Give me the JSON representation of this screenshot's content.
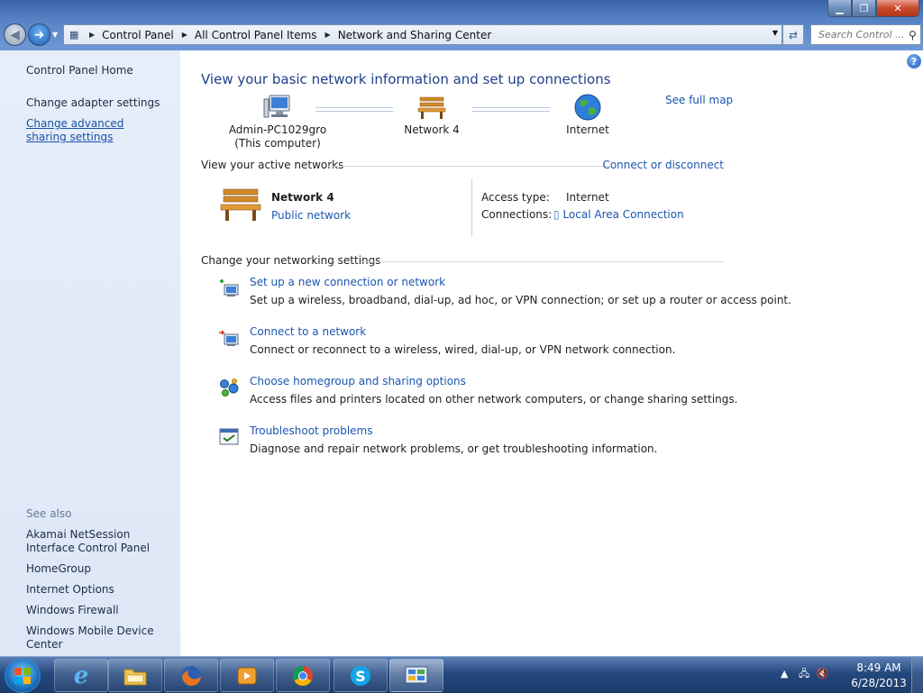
{
  "window": {
    "minimize_glyph": "▁",
    "maximize_glyph": "❐",
    "close_glyph": "✕"
  },
  "nav": {
    "breadcrumb": [
      "Control Panel",
      "All Control Panel Items",
      "Network and Sharing Center"
    ],
    "search_placeholder": "Search Control ..."
  },
  "sidebar": {
    "home": "Control Panel Home",
    "change_adapter": "Change adapter settings",
    "change_advanced": "Change advanced sharing settings",
    "see_also_label": "See also",
    "see_also": [
      "Akamai NetSession Interface Control Panel",
      "HomeGroup",
      "Internet Options",
      "Windows Firewall",
      "Windows Mobile Device Center"
    ]
  },
  "main": {
    "title": "View your basic network information and set up connections",
    "see_full_map": "See full map",
    "map": {
      "computer_name": "Admin-PC1029gro",
      "computer_sub": "(This computer)",
      "network": "Network  4",
      "internet": "Internet"
    },
    "active_header": "View your active networks",
    "connect_disconnect": "Connect or disconnect",
    "active_network": {
      "name": "Network  4",
      "type": "Public network",
      "access_label": "Access type:",
      "access_value": "Internet",
      "connections_label": "Connections:",
      "connections_value": "Local Area Connection"
    },
    "settings_header": "Change your networking settings",
    "tasks": [
      {
        "link": "Set up a new connection or network",
        "desc": "Set up a wireless, broadband, dial-up, ad hoc, or VPN connection; or set up a router or access point.",
        "icon": "new-connection-icon"
      },
      {
        "link": "Connect to a network",
        "desc": "Connect or reconnect to a wireless, wired, dial-up, or VPN network connection.",
        "icon": "connect-network-icon"
      },
      {
        "link": "Choose homegroup and sharing options",
        "desc": "Access files and printers located on other network computers, or change sharing settings.",
        "icon": "homegroup-icon"
      },
      {
        "link": "Troubleshoot problems",
        "desc": "Diagnose and repair network problems, or get troubleshooting information.",
        "icon": "troubleshoot-icon"
      }
    ]
  },
  "taskbar": {
    "time": "8:49 AM",
    "date": "6/28/2013"
  }
}
